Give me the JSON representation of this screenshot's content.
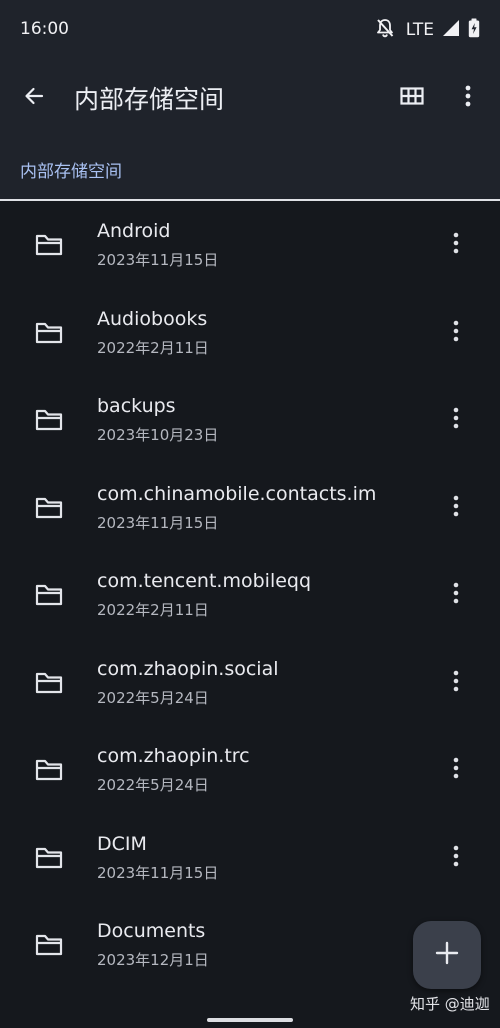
{
  "status_bar": {
    "time": "16:00",
    "network": "LTE",
    "icons": [
      "notifications-off-icon",
      "signal-icon",
      "battery-charging-icon"
    ]
  },
  "toolbar": {
    "title": "内部存储空间",
    "back_icon": "back-arrow-icon",
    "view_icon": "grid-view-icon",
    "more_icon": "more-vert-icon"
  },
  "breadcrumb": {
    "label": "内部存储空间"
  },
  "colors": {
    "background": "#15181d",
    "appbar": "#1f232b",
    "accent_text": "#a9c1f2",
    "primary_text": "#e9eaef",
    "secondary_text": "#b5b8c0",
    "fab": "#3b404b"
  },
  "files": [
    {
      "name": "Android",
      "date": "2023年11月15日",
      "icon": "folder-icon"
    },
    {
      "name": "Audiobooks",
      "date": "2022年2月11日",
      "icon": "folder-icon"
    },
    {
      "name": "backups",
      "date": "2023年10月23日",
      "icon": "folder-icon"
    },
    {
      "name": "com.chinamobile.contacts.im",
      "date": "2023年11月15日",
      "icon": "folder-icon"
    },
    {
      "name": "com.tencent.mobileqq",
      "date": "2022年2月11日",
      "icon": "folder-icon"
    },
    {
      "name": "com.zhaopin.social",
      "date": "2022年5月24日",
      "icon": "folder-icon"
    },
    {
      "name": "com.zhaopin.trc",
      "date": "2022年5月24日",
      "icon": "folder-icon"
    },
    {
      "name": "DCIM",
      "date": "2023年11月15日",
      "icon": "folder-icon"
    },
    {
      "name": "Documents",
      "date": "2023年12月1日",
      "icon": "folder-icon"
    }
  ],
  "fab": {
    "icon": "plus-icon"
  },
  "watermark": {
    "text": "知乎 @迪迦"
  }
}
